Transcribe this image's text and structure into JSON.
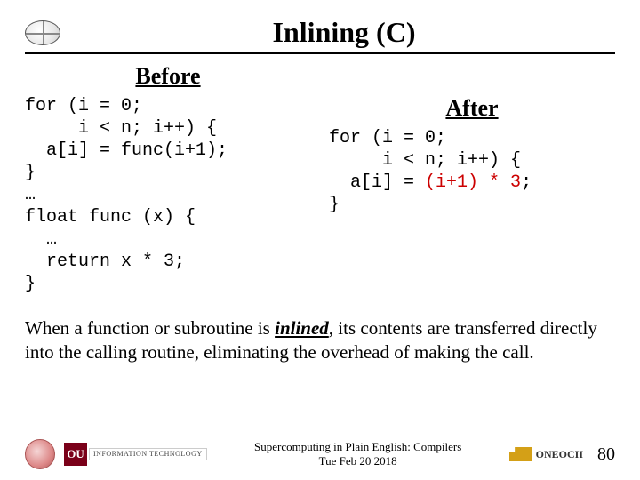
{
  "title": "Inlining (C)",
  "before": {
    "heading": "Before",
    "code": "for (i = 0;\n     i < n; i++) {\n  a[i] = func(i+1);\n}\n…\nfloat func (x) {\n  …\n  return x * 3;\n}"
  },
  "after": {
    "heading": "After",
    "prefix": "for (i = 0;\n     i < n; i++) {\n  a[i] = ",
    "highlight": "(i+1) * 3",
    "suffix": ";\n}"
  },
  "body": {
    "p1_pre": "When a function or subroutine is ",
    "p1_em": "inlined",
    "p1_post": ", its contents are transferred directly into the calling routine, eliminating the overhead of making the call."
  },
  "footer": {
    "center_line1": "Supercomputing in Plain English: Compilers",
    "center_line2": "Tue Feb 20 2018",
    "ou_mark": "OU",
    "ou_text": "INFORMATION TECHNOLOGY",
    "oneocii": "ONEOCII",
    "page": "80"
  }
}
